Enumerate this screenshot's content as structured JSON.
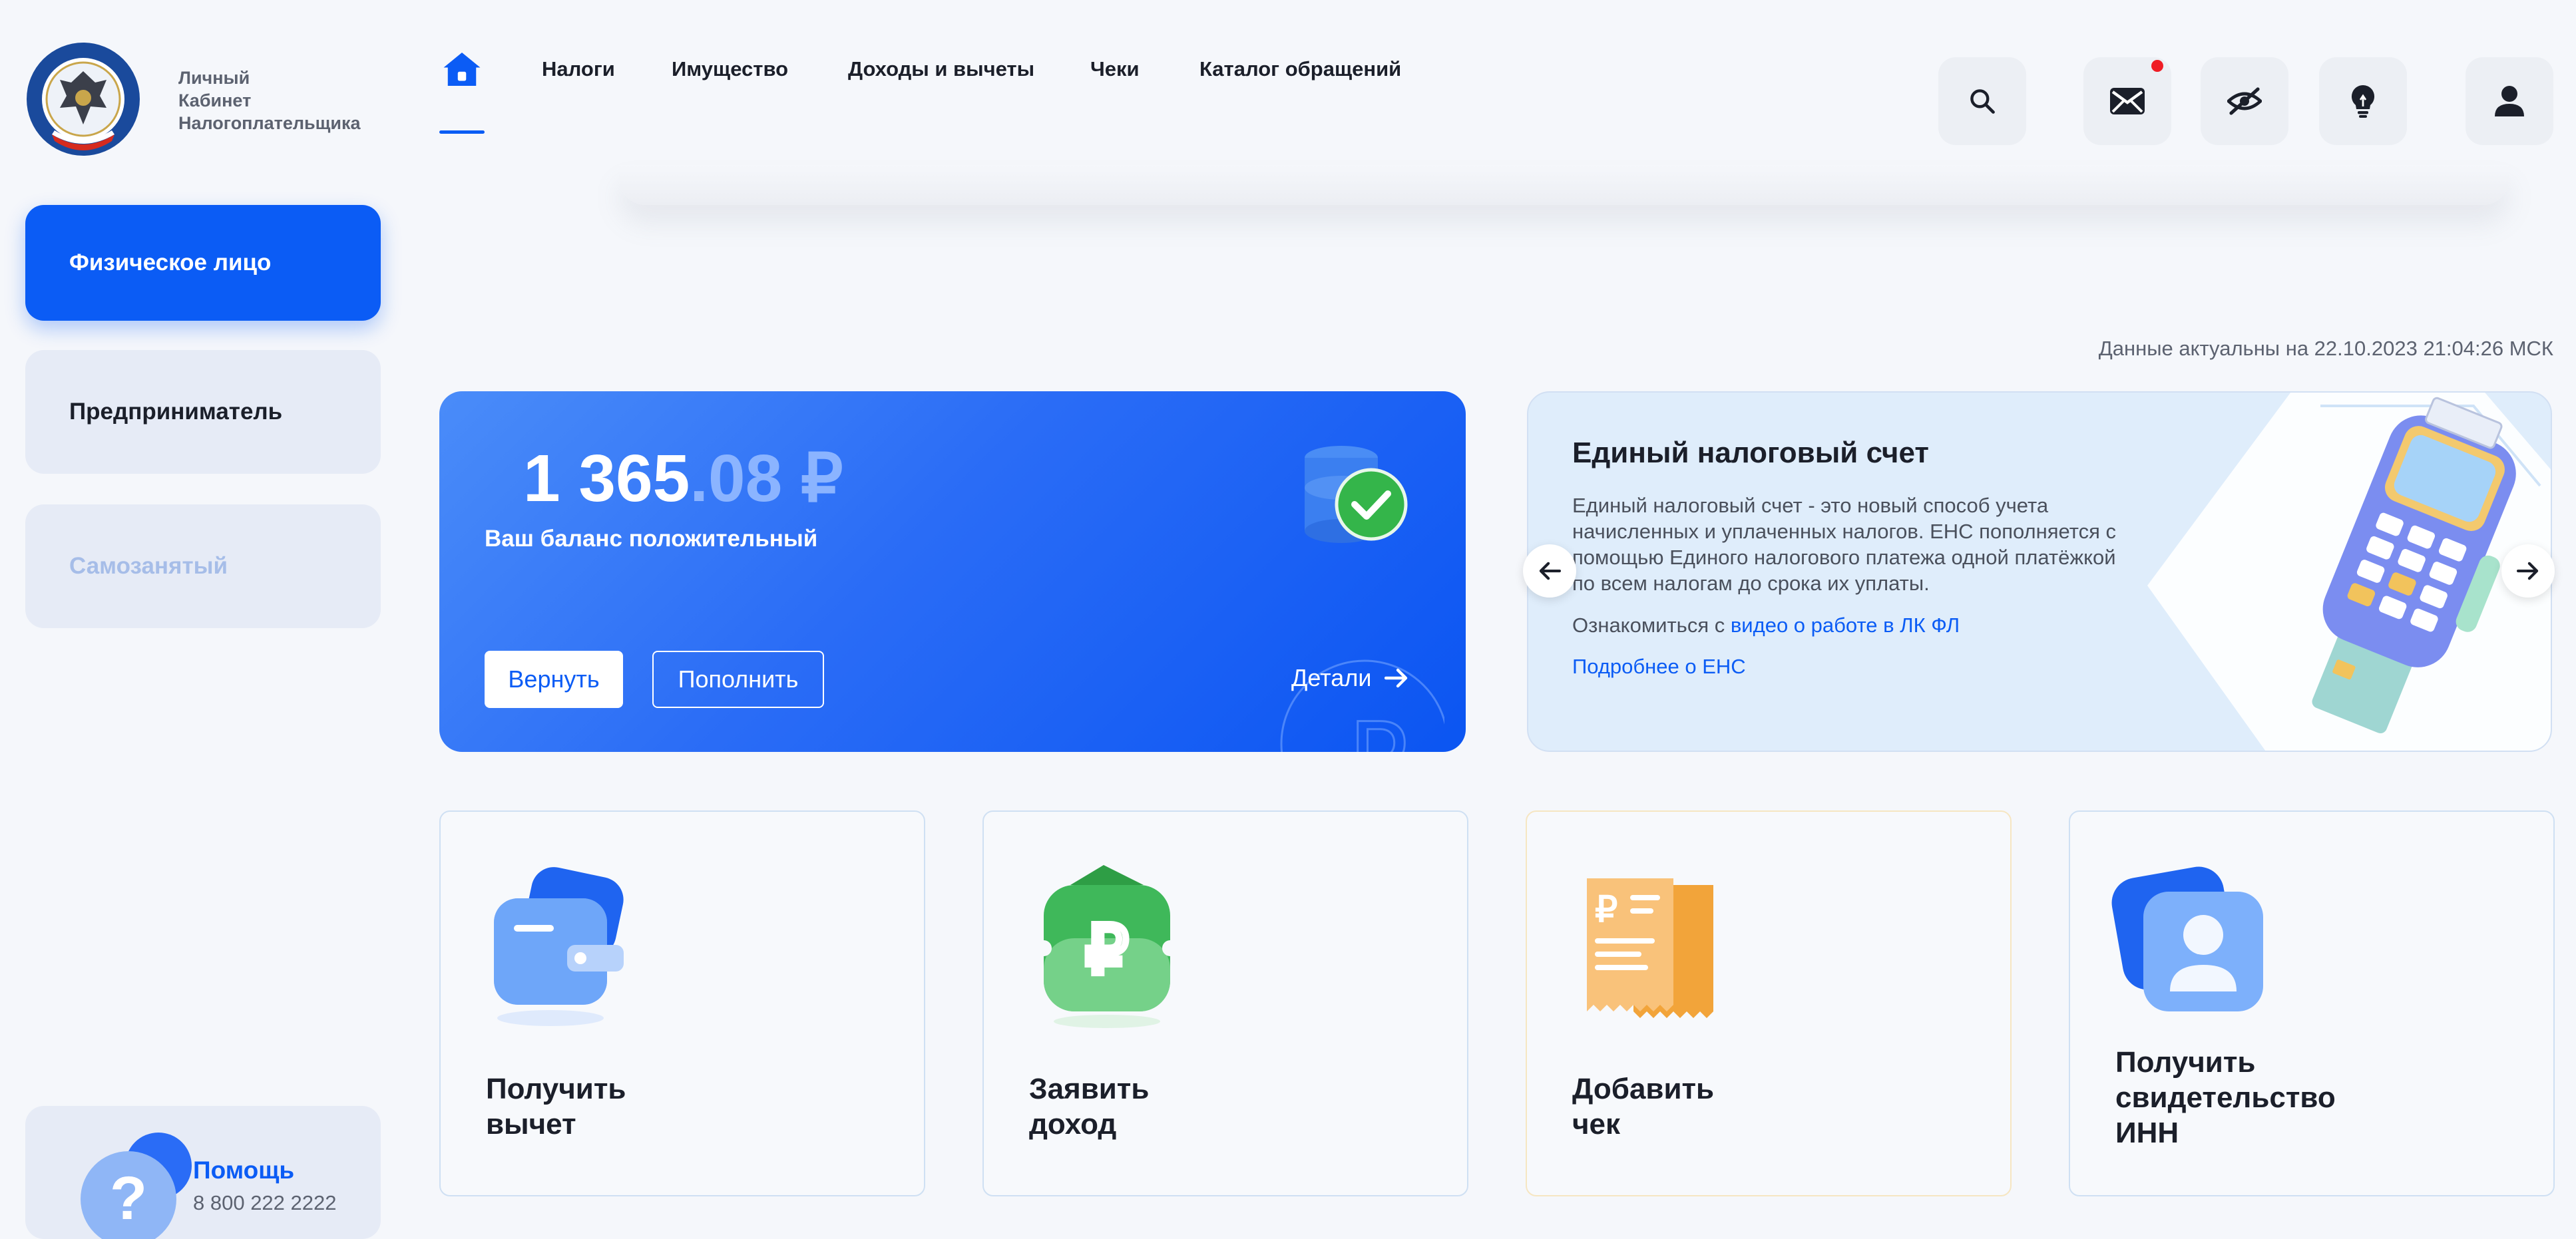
{
  "header": {
    "brand_lines": [
      "Личный",
      "Кабинет",
      "Налогоплательщика"
    ],
    "nav": [
      {
        "label": "Налоги"
      },
      {
        "label": "Имущество"
      },
      {
        "label": "Доходы и вычеты"
      },
      {
        "label": "Чеки"
      },
      {
        "label": "Каталог обращений"
      }
    ]
  },
  "sidebar": {
    "items": [
      {
        "label": "Физическое лицо",
        "state": "active"
      },
      {
        "label": "Предприниматель",
        "state": "normal"
      },
      {
        "label": "Самозанятый",
        "state": "disabled"
      }
    ],
    "help": {
      "title": "Помощь",
      "phone": "8 800 222 2222"
    }
  },
  "main": {
    "actual_text": "Данные актуальны на 22.10.2023 21:04:26 МСК",
    "balance": {
      "amount_int": "1 365",
      "amount_frac": ".08 ₽",
      "status": "Ваш баланс положительный",
      "refund_label": "Вернуть",
      "topup_label": "Пополнить",
      "details_label": "Детали"
    },
    "ens": {
      "title": "Единый налоговый счет",
      "text": "Единый налоговый счет - это новый способ учета начисленных и уплаченных налогов. ЕНС пополняется с помощью Единого налогового платежа одной платёжкой по всем налогам до срока их уплаты.",
      "link_prefix": "Ознакомиться с ",
      "link_label": "видео о работе в ЛК ФЛ",
      "more_label": "Подробнее о ЕНС"
    },
    "tiles": [
      {
        "line1": "Получить",
        "line2": "вычет",
        "line3": ""
      },
      {
        "line1": "Заявить",
        "line2": "доход",
        "line3": ""
      },
      {
        "line1": "Добавить",
        "line2": "чек",
        "line3": ""
      },
      {
        "line1": "Получить",
        "line2": "свидетельство",
        "line3": "ИНН"
      }
    ]
  },
  "colors": {
    "accent": "#0b5cf5",
    "notification": "#ef1d25",
    "page_bg": "#f5f7fb"
  }
}
